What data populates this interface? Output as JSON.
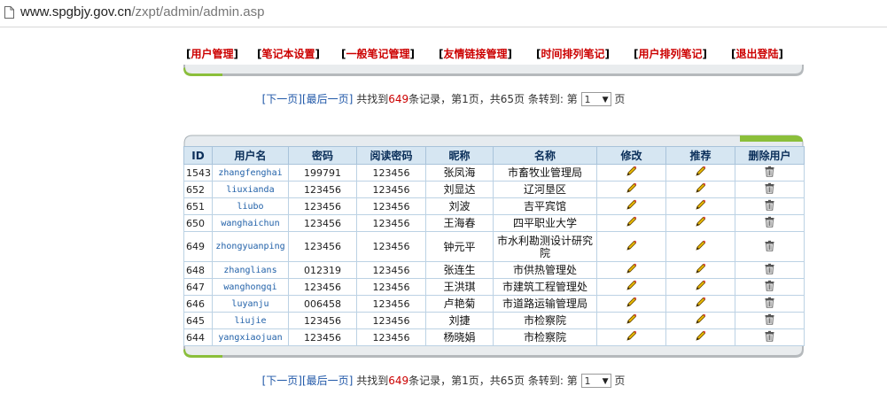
{
  "browser": {
    "url_host": "www.spgbjy.gov.cn",
    "url_path": "/zxpt/admin/admin.asp"
  },
  "nav": [
    {
      "label": "用户管理"
    },
    {
      "label": "笔记本设置"
    },
    {
      "label": "一般笔记管理"
    },
    {
      "label": "友情链接管理"
    },
    {
      "label": "时间排列笔记"
    },
    {
      "label": "用户排列笔记"
    },
    {
      "label": "退出登陆"
    }
  ],
  "pager": {
    "next": "[下一页]",
    "last": "[最后一页]",
    "found_prefix": "共找到",
    "count": "649",
    "found_suffix": "条记录，第1页，共65页 条转到: 第",
    "page_value": "1",
    "page_suffix": "页"
  },
  "table": {
    "headers": [
      "ID",
      "用户名",
      "密码",
      "阅读密码",
      "昵称",
      "名称",
      "修改",
      "推荐",
      "删除用户"
    ],
    "rows": [
      {
        "id": "1543",
        "username": "zhangfenghai",
        "password": "199791",
        "read_password": "123456",
        "nickname": "张凤海",
        "name": "市畜牧业管理局"
      },
      {
        "id": "652",
        "username": "liuxianda",
        "password": "123456",
        "read_password": "123456",
        "nickname": "刘显达",
        "name": "辽河垦区"
      },
      {
        "id": "651",
        "username": "liubo",
        "password": "123456",
        "read_password": "123456",
        "nickname": "刘波",
        "name": "吉平宾馆"
      },
      {
        "id": "650",
        "username": "wanghaichun",
        "password": "123456",
        "read_password": "123456",
        "nickname": "王海春",
        "name": "四平职业大学"
      },
      {
        "id": "649",
        "username": "zhongyuanping",
        "password": "123456",
        "read_password": "123456",
        "nickname": "钟元平",
        "name": "市水利勘测设计研究院"
      },
      {
        "id": "648",
        "username": "zhanglians",
        "password": "012319",
        "read_password": "123456",
        "nickname": "张连生",
        "name": "市供热管理处"
      },
      {
        "id": "647",
        "username": "wanghongqi",
        "password": "123456",
        "read_password": "123456",
        "nickname": "王洪琪",
        "name": "市建筑工程管理处"
      },
      {
        "id": "646",
        "username": "luyanju",
        "password": "006458",
        "read_password": "123456",
        "nickname": "卢艳菊",
        "name": "市道路运输管理局"
      },
      {
        "id": "645",
        "username": "liujie",
        "password": "123456",
        "read_password": "123456",
        "nickname": "刘捷",
        "name": "市检察院"
      },
      {
        "id": "644",
        "username": "yangxiaojuan",
        "password": "123456",
        "read_password": "123456",
        "nickname": "杨晓娟",
        "name": "市检察院"
      }
    ]
  },
  "icons": {
    "edit": "pencil-icon",
    "recommend": "pencil-icon",
    "delete": "trash-icon"
  },
  "colors": {
    "nav_text": "#cc0000",
    "link": "#1f57a8",
    "header_bg": "#d6e6f2",
    "accent_green": "#8bbf3a"
  }
}
